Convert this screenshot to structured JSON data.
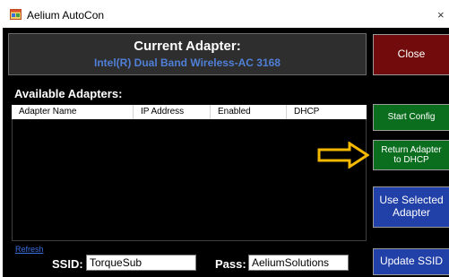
{
  "window": {
    "title": "Aelium AutoCon",
    "close_glyph": "×"
  },
  "current_panel": {
    "title": "Current Adapter:",
    "adapter_name": "Intel(R) Dual Band Wireless-AC 3168"
  },
  "adapters": {
    "label": "Available Adapters:",
    "columns": [
      "Adapter Name",
      "IP Address",
      "Enabled",
      "DHCP"
    ],
    "rows": []
  },
  "buttons": {
    "close": "Close",
    "start_config": "Start Config",
    "return_dhcp": "Return Adapter to DHCP",
    "use_selected": "Use Selected Adapter",
    "update_ssid": "Update SSID"
  },
  "refresh_link": "Refresh",
  "ssid": {
    "label": "SSID:",
    "value": "TorqueSub"
  },
  "pass": {
    "label": "Pass:",
    "value": "AeliumSolutions"
  },
  "icons": {
    "app": "app-window-icon",
    "annotation": "arrow-right-icon"
  },
  "colors": {
    "close_button": "#720b0b",
    "green_button": "#0b6e1f",
    "blue_button": "#2140a8",
    "adapter_text": "#4f7fd6",
    "arrow": "#f5b800"
  }
}
